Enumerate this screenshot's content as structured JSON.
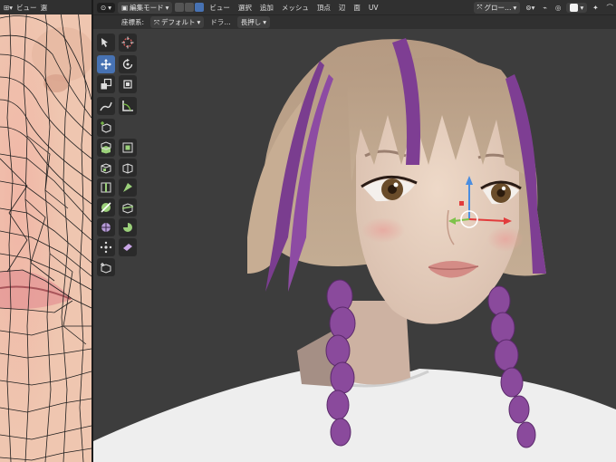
{
  "uv_header": {
    "view_label": "ビュー",
    "select_label": "選"
  },
  "header": {
    "mode": "編集モード",
    "menus": [
      "ビュー",
      "選択",
      "追加",
      "メッシュ",
      "頂点",
      "辺",
      "面",
      "UV"
    ],
    "orientation": "グロー…",
    "accent": "#4772b3"
  },
  "subbar": {
    "coord_label": "座標系:",
    "coord_value": "デフォルト",
    "drag_label": "ドラ…",
    "drag_value": "長押し"
  },
  "toolbar": {
    "tools": [
      "tweak-select-icon",
      "cursor-icon",
      "move-icon",
      "rotate-icon",
      "scale-icon",
      "transform-icon",
      "annotate-icon",
      "measure-icon",
      "add-cube-icon",
      "extrude-icon",
      "extrude-manifold-icon",
      "inset-icon",
      "bevel-icon",
      "loop-cut-icon",
      "offset-edge-icon",
      "knife-icon",
      "bisect-icon",
      "poly-build-icon",
      "spin-icon",
      "smooth-icon",
      "randomize-icon",
      "edge-slide-icon",
      "shrink-fatten-icon",
      "shear-icon",
      "rip-region-icon"
    ],
    "active_tool": "move-icon"
  },
  "gizmo": {
    "x_color": "#e23c3c",
    "y_color": "#7ec24a",
    "z_color": "#4a8de0"
  }
}
